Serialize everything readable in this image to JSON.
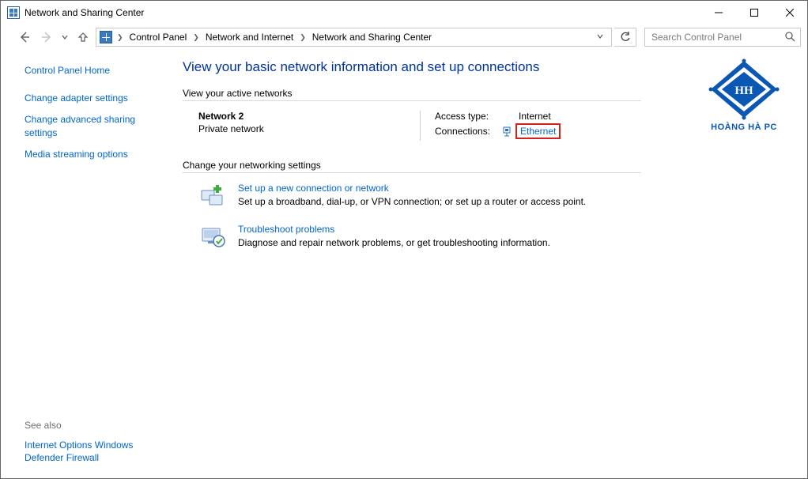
{
  "window": {
    "title": "Network and Sharing Center"
  },
  "breadcrumb": {
    "items": [
      "Control Panel",
      "Network and Internet",
      "Network and Sharing Center"
    ]
  },
  "search": {
    "placeholder": "Search Control Panel"
  },
  "sidebar": {
    "home": "Control Panel Home",
    "links": [
      "Change adapter settings",
      "Change advanced sharing settings",
      "Media streaming options"
    ],
    "seealso_label": "See also",
    "seealso": [
      "Internet Options",
      "Windows Defender Firewall"
    ]
  },
  "main": {
    "heading": "View your basic network information and set up connections",
    "active_label": "View your active networks",
    "network": {
      "name": "Network 2",
      "type": "Private network",
      "access_key": "Access type:",
      "access_val": "Internet",
      "conn_key": "Connections:",
      "conn_val": "Ethernet"
    },
    "change_label": "Change your networking settings",
    "items": [
      {
        "title": "Set up a new connection or network",
        "desc": "Set up a broadband, dial-up, or VPN connection; or set up a router or access point."
      },
      {
        "title": "Troubleshoot problems",
        "desc": "Diagnose and repair network problems, or get troubleshooting information."
      }
    ]
  },
  "brand": {
    "label": "HOÀNG HÀ PC"
  }
}
